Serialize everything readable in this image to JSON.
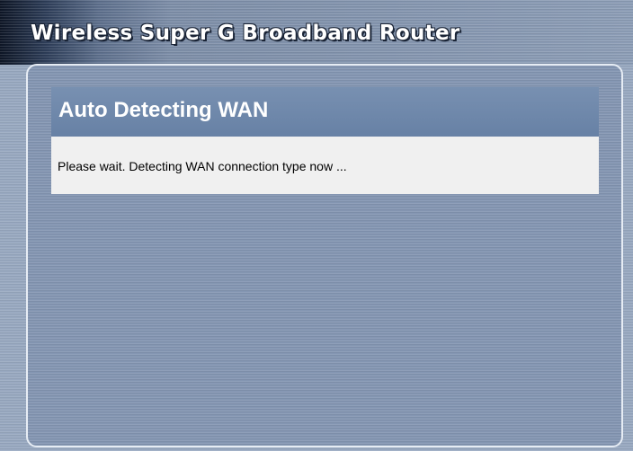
{
  "header": {
    "title": "Wireless Super G Broadband Router"
  },
  "section": {
    "title": "Auto Detecting WAN",
    "message": "Please wait. Detecting WAN connection type now ..."
  },
  "colors": {
    "background": "#98a8c0",
    "section_header": "#6b84a7",
    "message_box": "#f0f0f0",
    "frame_border": "#e6ecf4",
    "title_text": "#ffffff"
  }
}
